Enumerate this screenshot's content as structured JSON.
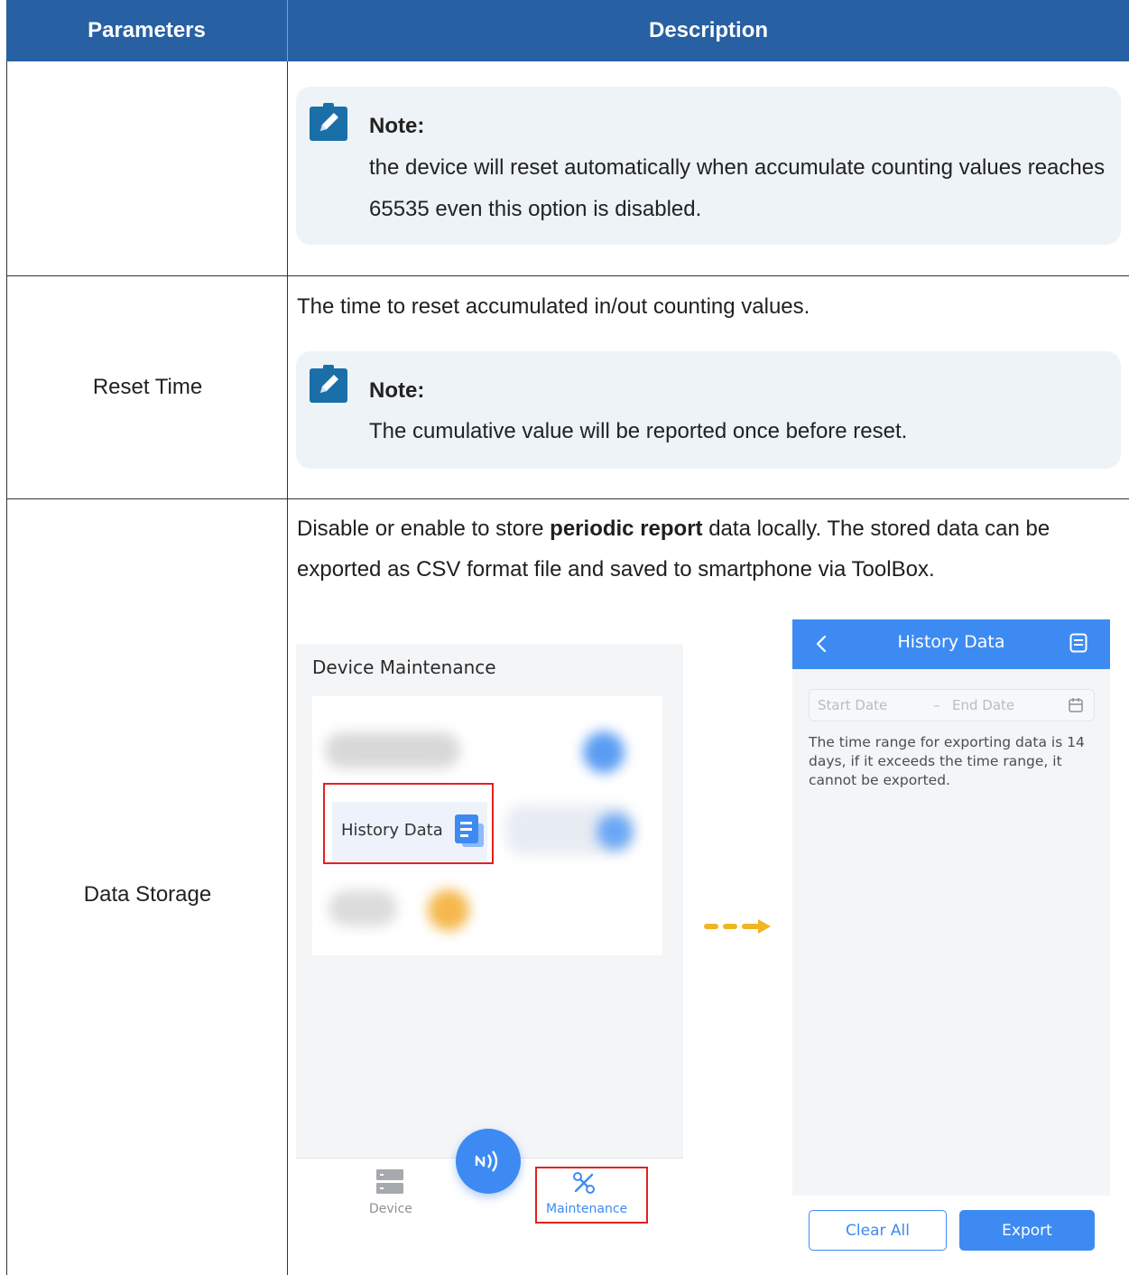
{
  "table": {
    "headers": {
      "parameters": "Parameters",
      "description": "Description"
    }
  },
  "row1": {
    "note": {
      "title": "Note:",
      "text": "the device will reset automatically when accumulate counting values reaches 65535 even this option is disabled."
    }
  },
  "row2": {
    "parameter": "Reset Time",
    "description": "The time to reset accumulated in/out counting values.",
    "note": {
      "title": "Note:",
      "text": "The cumulative value will be reported once before reset."
    }
  },
  "row3": {
    "parameter": "Data Storage",
    "description_before": "Disable or enable to store ",
    "description_bold": "periodic report",
    "description_after": " data locally. The stored data can be exported as CSV format file and saved to smartphone via ToolBox."
  },
  "app_maintenance": {
    "title": "Device Maintenance",
    "history_tile": "History Data",
    "tabs": {
      "device": "Device",
      "maintenance": "Maintenance"
    }
  },
  "app_history": {
    "title": "History Data",
    "start_date": "Start Date",
    "end_date": "End Date",
    "info": "The time range for exporting data is 14 days, if it exceeds the time range, it cannot be exported.",
    "clear_all": "Clear All",
    "export": "Export"
  },
  "colors": {
    "header_bg": "#2760a3",
    "note_bg": "#edf3f6",
    "icon_blue": "#1a6fa8",
    "app_blue": "#3d8bf2",
    "highlight_red": "#e32020",
    "arrow_yellow": "#f2b522"
  },
  "icons": [
    "edit-note-icon",
    "doc-list-icon",
    "nfc-icon",
    "server-icon",
    "tools-icon",
    "back-chevron-icon",
    "document-icon",
    "calendar-icon",
    "arrow-right-icon"
  ]
}
